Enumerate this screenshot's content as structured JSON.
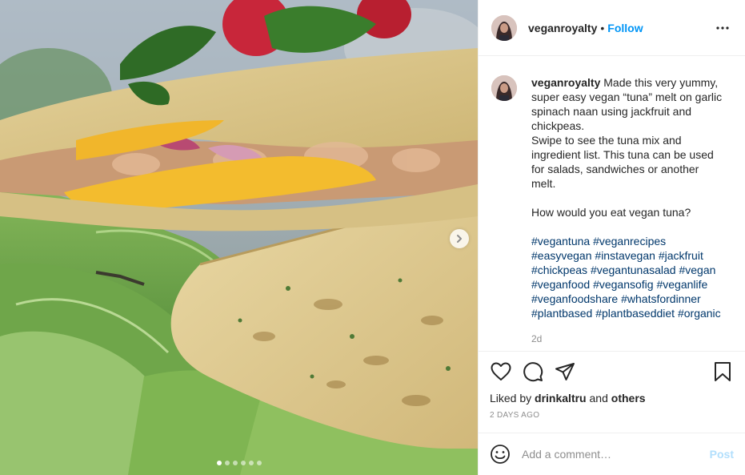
{
  "header": {
    "username": "veganroyalty",
    "separator": "•",
    "follow_label": "Follow",
    "more_icon": "more-horizontal-icon"
  },
  "caption": {
    "username": "veganroyalty",
    "lines": [
      "Made this very yummy,",
      "super easy vegan “tuna” melt on garlic",
      "spinach naan using jackfruit and",
      "chickpeas.",
      "Swipe to see the tuna mix and",
      "ingredient list. This tuna can be used",
      "for salads, sandwiches or another",
      "melt."
    ],
    "question": "How would you eat vegan tuna?",
    "hashtag_lines": [
      [
        "#vegantuna",
        "#veganrecipes"
      ],
      [
        "#easyvegan",
        "#instavegan",
        "#jackfruit"
      ],
      [
        "#chickpeas",
        "#vegantunasalad",
        "#vegan"
      ],
      [
        "#veganfood",
        "#vegansofig",
        "#veganlife"
      ],
      [
        "#veganfoodshare",
        "#whatsfordinner"
      ],
      [
        "#plantbased",
        "#plantbaseddiet",
        "#organic"
      ]
    ],
    "age": "2d"
  },
  "actions": {
    "icons": [
      "heart-icon",
      "comment-icon",
      "share-icon",
      "bookmark-icon"
    ],
    "liked_prefix": "Liked by",
    "liked_user": "drinkaltru",
    "liked_and": "and",
    "liked_others": "others",
    "date": "2 DAYS AGO"
  },
  "comment": {
    "emoji_icon": "emoji-icon",
    "placeholder": "Add a comment…",
    "post_label": "Post"
  },
  "media": {
    "next_icon": "chevron-right-icon",
    "slide_count": 6,
    "active_slide": 1
  },
  "colors": {
    "accent": "#0095f6",
    "hashtag": "#00376b",
    "muted": "#8e8e8e",
    "post_disabled": "#b2dffc"
  }
}
